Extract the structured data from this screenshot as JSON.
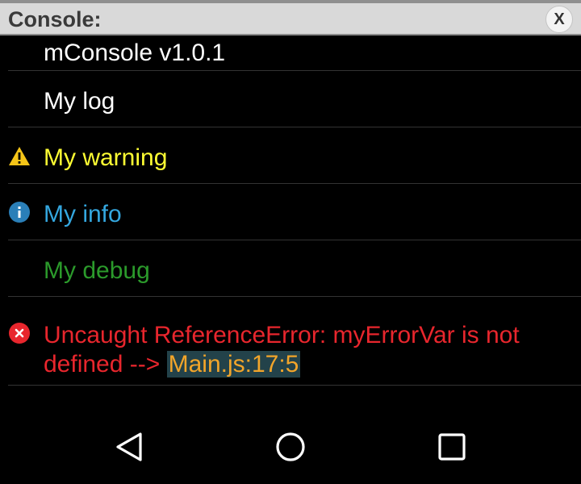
{
  "console": {
    "title": "Console:",
    "close_label": "X"
  },
  "entries": [
    {
      "level": "log",
      "text": "mConsole v1.0.1"
    },
    {
      "level": "log",
      "text": "My log"
    },
    {
      "level": "warning",
      "icon": "warning-icon",
      "text": "My warning"
    },
    {
      "level": "info",
      "icon": "info-icon",
      "text": "My info"
    },
    {
      "level": "debug",
      "text": "My debug"
    },
    {
      "level": "error",
      "icon": "error-icon",
      "text": "Uncaught ReferenceError: myErrorVar is not defined -->",
      "link": "Main.js:17:5"
    }
  ],
  "navbar": {
    "buttons": [
      "back-icon",
      "home-icon",
      "recents-icon"
    ]
  },
  "colors": {
    "background": "#000000",
    "titlebar": "#d9d9d9",
    "log": "#ffffff",
    "warning": "#ffff33",
    "info": "#34a7df",
    "debug": "#2b9a2b",
    "error": "#e8262d",
    "link_text": "#f2a52a",
    "link_background": "#23424a"
  }
}
